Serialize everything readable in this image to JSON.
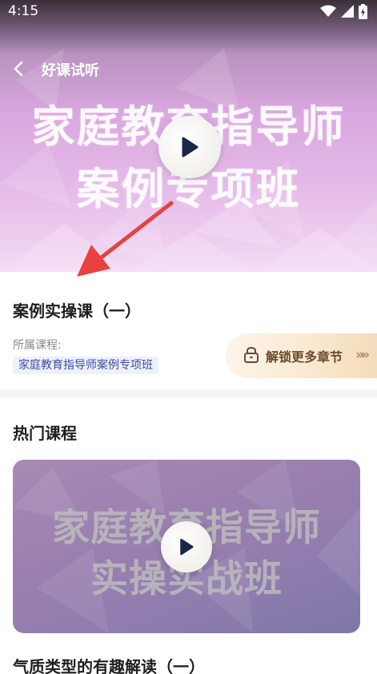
{
  "status_bar": {
    "time": "4:15"
  },
  "nav": {
    "title": "好课试听"
  },
  "hero": {
    "title_line1": "家庭教育指导师",
    "title_line2": "案例专项班"
  },
  "lesson": {
    "title": "案例实操课（一）",
    "course_label": "所属课程:",
    "course_name": "家庭教育指导师案例专项班",
    "unlock_label": "解锁更多章节",
    "unlock_chevrons": "»»"
  },
  "hot": {
    "section_title": "热门课程",
    "card_title_line1": "家庭教育指导师",
    "card_title_line2": "实操实战班",
    "course_name": "气质类型的有趣解读（一）"
  },
  "colors": {
    "accent_red": "#e8413f",
    "tag_text": "#3c4a9e",
    "unlock_text": "#6b4a2e"
  },
  "icons": [
    "wifi-icon",
    "signal-icon",
    "battery-icon",
    "back-icon",
    "play-icon",
    "lock-icon",
    "chevron-double-right-icon",
    "arrow-annotation"
  ]
}
